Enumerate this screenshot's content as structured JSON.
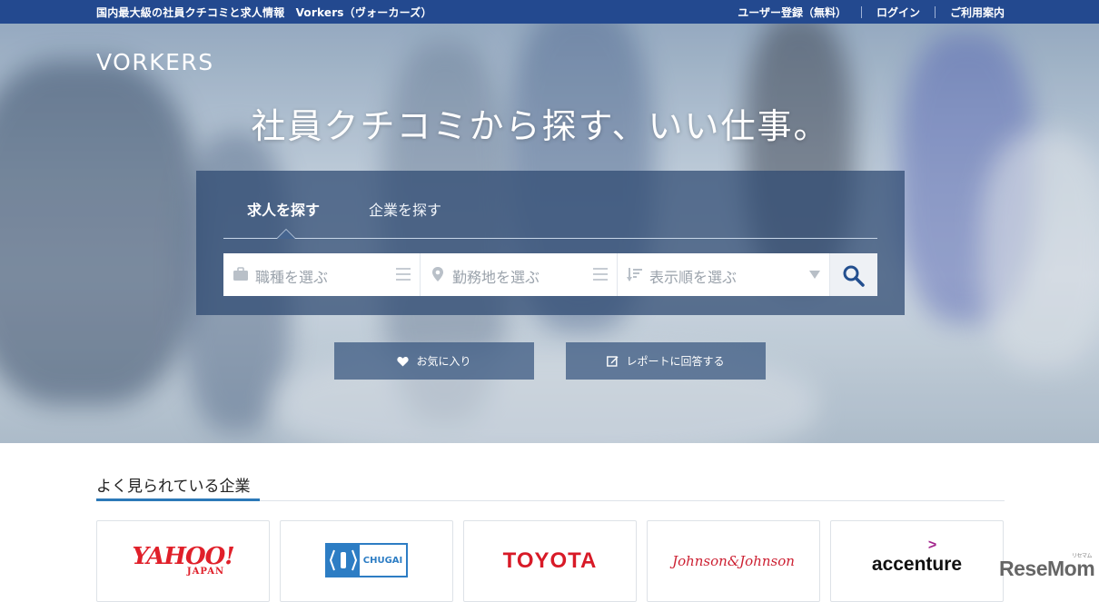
{
  "topbar": {
    "tagline": "国内最大級の社員クチコミと求人情報　Vorkers（ヴォーカーズ）",
    "register": "ユーザー登録（無料）",
    "login": "ログイン",
    "guide": "ご利用案内"
  },
  "hero": {
    "logo": "VORKERS",
    "headline": "社員クチコミから探す、いい仕事。"
  },
  "search": {
    "tabs": [
      {
        "label": "求人を探す"
      },
      {
        "label": "企業を探す"
      }
    ],
    "fields": [
      {
        "label": "職種を選ぶ",
        "icon": "briefcase-icon"
      },
      {
        "label": "勤務地を選ぶ",
        "icon": "location-pin-icon"
      },
      {
        "label": "表示順を選ぶ",
        "icon": "sort-icon"
      }
    ],
    "button_icon": "search-icon"
  },
  "actions": {
    "favorites": "お気に入り",
    "report": "レポートに回答する"
  },
  "popular": {
    "title": "よく見られている企業",
    "companies": [
      {
        "name": "YAHOO!",
        "sub": "JAPAN"
      },
      {
        "name": "CHUGAI"
      },
      {
        "name": "TOYOTA"
      },
      {
        "name": "Johnson&Johnson"
      },
      {
        "name": "accenture"
      }
    ]
  },
  "watermark": {
    "text": "ReseMom",
    "sub": "リセマム"
  },
  "colors": {
    "topbar": "#23498f",
    "panel": "#2c4870",
    "accent": "#2c79b8"
  }
}
